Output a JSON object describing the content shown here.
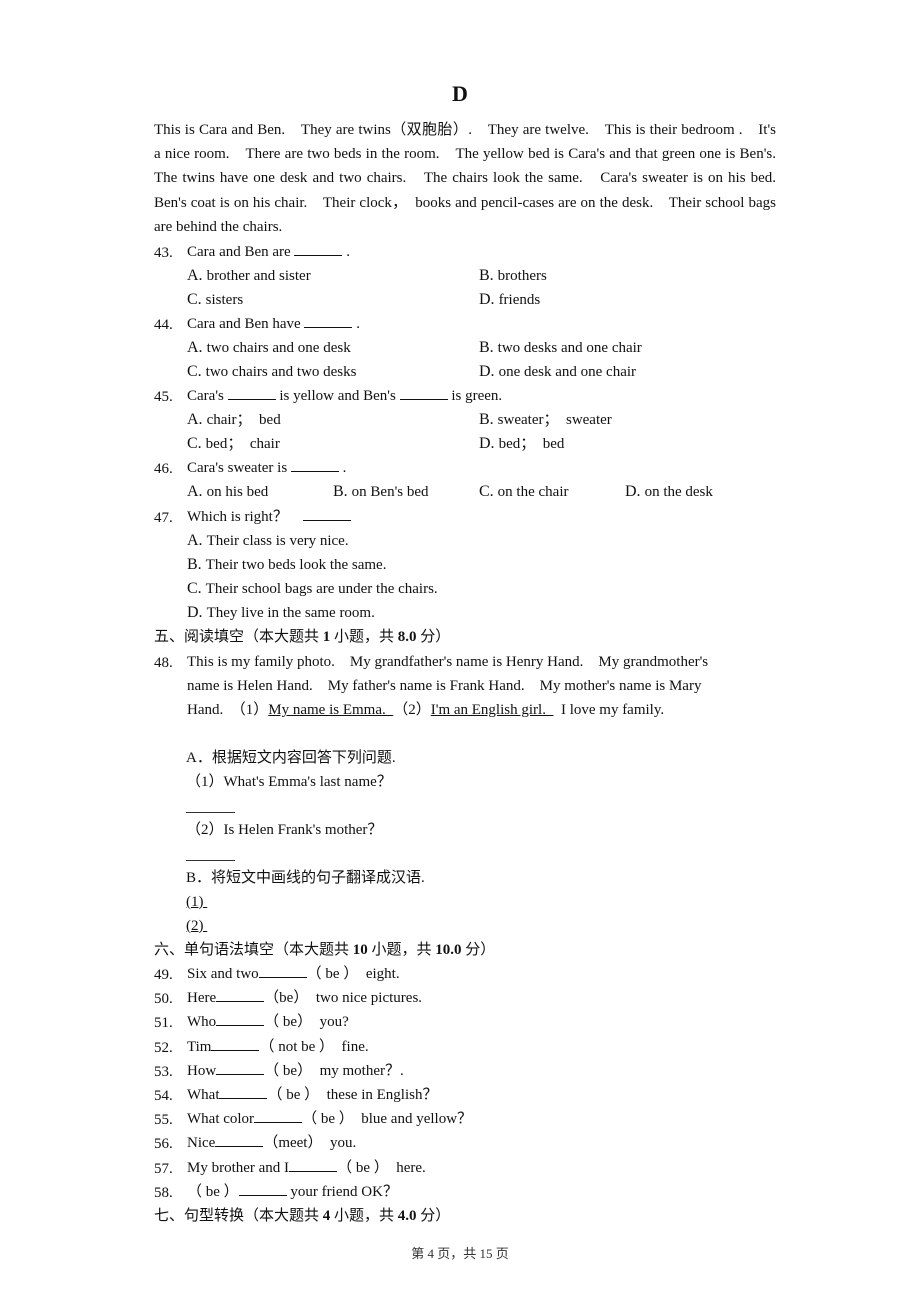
{
  "title": "D",
  "passage": "This is Cara and Ben.　They are twins（双胞胎）.　They are twelve.　This is their bedroom .　It's a nice room.　There are two beds in the room.　The yellow bed is Cara's and that green one is Ben's.　The twins have one desk and two chairs.　The chairs look the same.　Cara's sweater is on his bed.　Ben's coat is on his chair.　Their clock，　books and pencil-cases are on the desk.　Their school bags are behind the chairs.",
  "mc_questions": [
    {
      "num": "43.",
      "stem_pre": "Cara and Ben are ",
      "stem_post": " .",
      "options": [
        {
          "letter": "A.",
          "text": "brother and sister"
        },
        {
          "letter": "B.",
          "text": "brothers"
        },
        {
          "letter": "C.",
          "text": "sisters"
        },
        {
          "letter": "D.",
          "text": "friends"
        }
      ]
    },
    {
      "num": "44.",
      "stem_pre": "Cara and Ben have ",
      "stem_post": " .",
      "options": [
        {
          "letter": "A.",
          "text": "two chairs and one desk"
        },
        {
          "letter": "B.",
          "text": "two desks and one chair"
        },
        {
          "letter": "C.",
          "text": "two chairs and two desks"
        },
        {
          "letter": "D.",
          "text": "one desk and one chair"
        }
      ]
    },
    {
      "num": "45.",
      "stem_pre": "Cara's ",
      "stem_mid": " is yellow and Ben's ",
      "stem_post": " is green.",
      "options": [
        {
          "letter": "A.",
          "text": "chair；　bed"
        },
        {
          "letter": "B.",
          "text": "sweater；　sweater"
        },
        {
          "letter": "C.",
          "text": "bed；　chair"
        },
        {
          "letter": "D.",
          "text": "bed；　bed"
        }
      ]
    },
    {
      "num": "46.",
      "stem_pre": "Cara's sweater is ",
      "stem_post": " .",
      "options": [
        {
          "letter": "A.",
          "text": "on his bed"
        },
        {
          "letter": "B.",
          "text": "on Ben's bed"
        },
        {
          "letter": "C.",
          "text": "on the chair"
        },
        {
          "letter": "D.",
          "text": "on the desk"
        }
      ]
    },
    {
      "num": "47.",
      "stem_pre": "Which is right？　",
      "stem_post": "",
      "options": [
        {
          "letter": "A.",
          "text": "Their class is very nice."
        },
        {
          "letter": "B.",
          "text": "Their two beds look the same."
        },
        {
          "letter": "C.",
          "text": "Their school bags are under the chairs."
        },
        {
          "letter": "D.",
          "text": "They live in the same room."
        }
      ]
    }
  ],
  "section5": {
    "prefix": "五、阅读填空（本大题共 ",
    "count": "1",
    "mid": " 小题，共 ",
    "score": "8.0",
    "suffix": " 分）"
  },
  "q48": {
    "num": "48.",
    "line1": "This is my family photo.　My grandfather's name is Henry Hand.　My grandmother's",
    "line2": "name is Helen Hand.　My father's name is Frank Hand.　My mother's name is Mary",
    "line3_pre": "Hand.　（1）",
    "underline1": "My name is Emma.  ",
    "line3_mid": "（2）",
    "underline2": "I'm an English girl.  ",
    "line3_post": "I love my family.",
    "partA": "A．根据短文内容回答下列问题.",
    "qa1": "（1）What's Emma's last name？",
    "qa2": "（2）Is Helen Frank's mother？",
    "partB": "B．将短文中画线的句子翻译成汉语.",
    "b1": "(1) ",
    "b2": "(2) "
  },
  "section6": {
    "prefix": "六、单句语法填空（本大题共 ",
    "count": "10",
    "mid": " 小题，共 ",
    "score": "10.0",
    "suffix": " 分）"
  },
  "grammar": [
    {
      "num": "49.",
      "pre": "Six and two",
      "post": "（ be ）　eight."
    },
    {
      "num": "50.",
      "pre": "Here",
      "post": "（be）　two nice pictures."
    },
    {
      "num": "51.",
      "pre": "Who",
      "post": "（ be）　you?"
    },
    {
      "num": "52.",
      "pre": "Tim",
      "post": "（ not be ）　fine."
    },
    {
      "num": "53.",
      "pre": "How",
      "post": "（ be）　my mother？."
    },
    {
      "num": "54.",
      "pre": "What",
      "post": "（ be ）　these in English？"
    },
    {
      "num": "55.",
      "pre": "What color",
      "post": "（ be ）　blue and yellow？"
    },
    {
      "num": "56.",
      "pre": "Nice",
      "post": "（meet）　you."
    },
    {
      "num": "57.",
      "pre": "My brother and I",
      "post": "（ be ）　here."
    },
    {
      "num": "58.",
      "pre": "（ be ）",
      "post": " your friend OK？",
      "blank_after_pre": true
    }
  ],
  "section7": {
    "prefix": "七、句型转换（本大题共 ",
    "count": "4",
    "mid": " 小题，共 ",
    "score": "4.0",
    "suffix": " 分）"
  },
  "footer": "第 4 页，共 15 页"
}
